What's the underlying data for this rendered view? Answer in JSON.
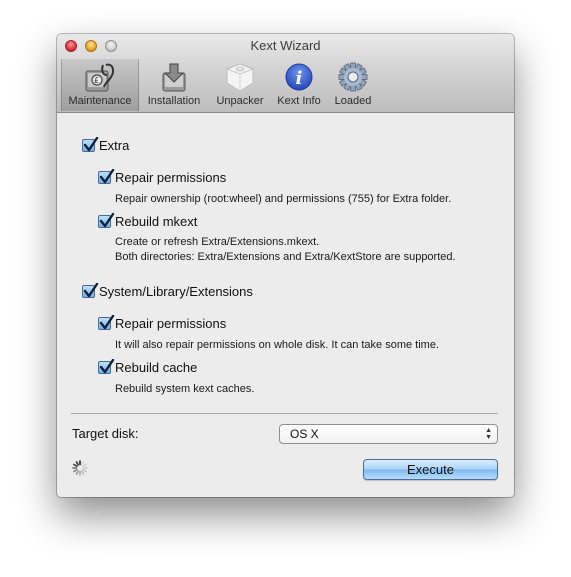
{
  "window": {
    "title": "Kext Wizard"
  },
  "toolbar": {
    "items": [
      {
        "label": "Maintenance",
        "icon": "disk-stethoscope-icon",
        "selected": true
      },
      {
        "label": "Installation",
        "icon": "disk-install-icon",
        "selected": false
      },
      {
        "label": "Unpacker",
        "icon": "package-box-icon",
        "selected": false
      },
      {
        "label": "Kext Info",
        "icon": "info-icon",
        "selected": false
      },
      {
        "label": "Loaded",
        "icon": "gear-icon",
        "selected": false
      }
    ]
  },
  "sections": {
    "extra": {
      "label": "Extra",
      "checked": true,
      "options": [
        {
          "label": "Repair permissions",
          "checked": true,
          "description": [
            "Repair ownership (root:wheel) and permissions (755) for Extra folder."
          ]
        },
        {
          "label": "Rebuild mkext",
          "checked": true,
          "description": [
            "Create or refresh Extra/Extensions.mkext.",
            "Both directories: Extra/Extensions and Extra/KextStore are supported."
          ]
        }
      ]
    },
    "system": {
      "label": "System/Library/Extensions",
      "checked": true,
      "options": [
        {
          "label": "Repair permissions",
          "checked": true,
          "description": [
            "It will also repair permissions on whole disk. It can take some time."
          ]
        },
        {
          "label": "Rebuild cache",
          "checked": true,
          "description": [
            "Rebuild system kext caches."
          ]
        }
      ]
    }
  },
  "target": {
    "label": "Target disk:",
    "selected": "OS X"
  },
  "actions": {
    "execute_label": "Execute"
  },
  "colors": {
    "checkbox_fill": "#6fb1ec",
    "execute_button": "#a9d2f7",
    "close_light": "#e2393f",
    "minimize_light": "#f0a929",
    "info_icon_blue": "#2f55c9"
  }
}
